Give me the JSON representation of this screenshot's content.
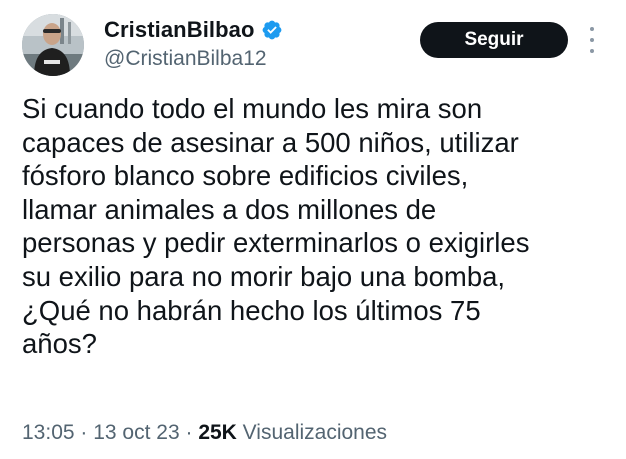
{
  "author": {
    "display_name": "CristianBilbao",
    "handle": "@CristianBilba12",
    "verified_icon": "verified-badge-icon",
    "verified_color": "#1d9bf0"
  },
  "actions": {
    "follow_label": "Seguir",
    "more_icon": "more-options-icon"
  },
  "tweet": {
    "text_lines": [
      "Si cuando todo el mundo les mira son",
      "capaces de asesinar a 500 niños, utilizar",
      "fósforo blanco sobre edificios civiles,",
      "llamar animales a dos millones de",
      "personas y pedir exterminarlos o exigirles",
      "su exilio para no morir bajo una bomba,",
      "¿Qué no habrán hecho los últimos 75",
      "años?"
    ]
  },
  "meta": {
    "time": "13:05",
    "separator": "·",
    "date": "13 oct 23",
    "views_count": "25K",
    "views_label": "Visualizaciones"
  },
  "colors": {
    "text": "#0f1419",
    "secondary": "#536471",
    "button_bg": "#0f1419",
    "button_text": "#ffffff"
  }
}
